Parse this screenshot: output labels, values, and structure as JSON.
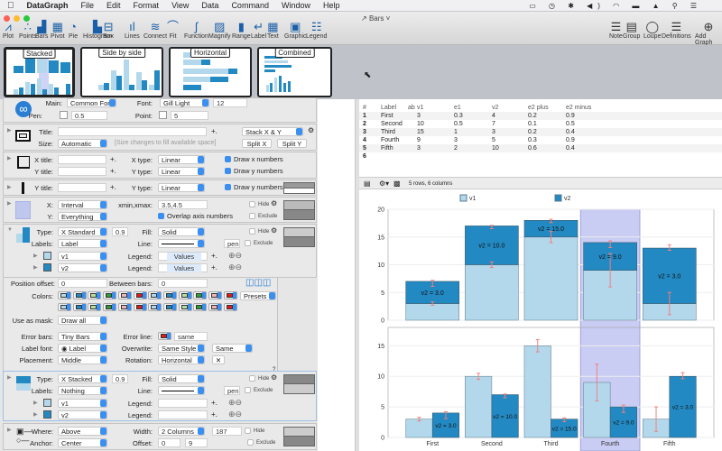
{
  "menubar": {
    "app": "DataGraph",
    "items": [
      "File",
      "Edit",
      "Format",
      "View",
      "Data",
      "Command",
      "Window",
      "Help"
    ]
  },
  "window": {
    "title": "Bars"
  },
  "toolbar": {
    "left": [
      "Plot",
      "Points",
      "Bars",
      "Pivot",
      "Pie",
      "Histogram",
      "Box",
      "Lines",
      "Connect",
      "Fit",
      "Function",
      "Magnify",
      "Range",
      "Label",
      "Text",
      "Graphic",
      "Legend"
    ],
    "right": [
      "Note",
      "Group",
      "Loupe",
      "Definitions",
      "Add Graph"
    ]
  },
  "thumbnails": [
    "Stacked",
    "Side by side",
    "Horizontal",
    "Combined"
  ],
  "panel": {
    "style": {
      "main_label": "Main:",
      "main": "Common Font",
      "font_label": "Font:",
      "font": "Gill Light",
      "font_size": "12",
      "pen_label": "Pen:",
      "pen": "0.5",
      "point_label": "Point:",
      "point": "5"
    },
    "canvas": {
      "title_label": "Title:",
      "title": "",
      "layout": "Stack X & Y",
      "size_label": "Size:",
      "size": "Automatic",
      "size_hint": "[Size changes to fill available space]",
      "split_x": "Split X",
      "split_y": "Split Y"
    },
    "axes": {
      "xtitle_label": "X title:",
      "ytitle_label": "Y title:",
      "xtype_label": "X type:",
      "xtype": "Linear",
      "ytype_label": "Y type:",
      "ytype": "Linear",
      "draw_x": "Draw x numbers",
      "draw_y": "Draw y numbers"
    },
    "axes2": {
      "ytitle_label": "Y title:",
      "ytype_label": "Y type:",
      "ytype": "Linear",
      "draw_y": "Draw y numbers"
    },
    "range": {
      "x_label": "X:",
      "x": "Interval",
      "xminmax_label": "xmin,xmax:",
      "xminmax": "3.5,4.5",
      "y_label": "Y:",
      "y": "Everything",
      "overlap": "Overlap axis numbers",
      "hide": "Hide",
      "exclude": "Exclude"
    },
    "bars1": {
      "type_label": "Type:",
      "type": "X Standard",
      "width": "0.9",
      "fill_label": "Fill:",
      "fill": "Solid",
      "labels_label": "Labels:",
      "labels": "Label",
      "line_label": "Line:",
      "pen": "pen",
      "hide": "Hide",
      "exclude": "Exclude",
      "series": [
        {
          "name": "v1",
          "legend_label": "Legend:",
          "legend": "Values",
          "color": "#b3d8ec"
        },
        {
          "name": "v2",
          "legend_label": "Legend:",
          "legend": "Values",
          "color": "#2389c2"
        }
      ],
      "pos_offset_label": "Position offset:",
      "pos_offset": "0",
      "between_label": "Between bars:",
      "between": "0",
      "colors_label": "Colors:",
      "presets": "Presets",
      "palette": [
        "#b3d8ec",
        "#2389c2",
        "#b8e09a",
        "#2e9e36",
        "#f2b4b4",
        "#e01b1b",
        "#b3d8ec",
        "#2389c2",
        "#b8e09a",
        "#2e9e36",
        "#f2b4b4",
        "#e01b1b"
      ],
      "mask_label": "Use as mask:",
      "mask": "Draw all",
      "errbars_label": "Error bars:",
      "errbars": "Tiny Bars",
      "errline_label": "Error line:",
      "errline": "same",
      "errcolor": "#e01b1b",
      "labelfont_label": "Label font:",
      "labelfont": "Label",
      "overwrite_label": "Overwrite:",
      "overwrite": "Same Style",
      "same": "Same",
      "placement_label": "Placement:",
      "placement": "Middle",
      "rotation_label": "Rotation:",
      "rotation": "Horizontal",
      "help": "?"
    },
    "bars2": {
      "type_label": "Type:",
      "type": "X Stacked",
      "width": "0.9",
      "fill_label": "Fill:",
      "fill": "Solid",
      "labels_label": "Labels:",
      "labels": "Nothing",
      "line_label": "Line:",
      "pen": "pen",
      "hide": "Hide",
      "exclude": "Exclude",
      "series": [
        {
          "name": "v1",
          "legend_label": "Legend:",
          "legend": "",
          "color": "#b3d8ec"
        },
        {
          "name": "v2",
          "legend_label": "Legend:",
          "legend": "",
          "color": "#2389c2"
        }
      ]
    },
    "legend": {
      "where_label": "Where:",
      "where": "Above",
      "width_label": "Width:",
      "width": "2 Columns",
      "width_val": "187",
      "anchor_label": "Anchor:",
      "anchor": "Center",
      "offset_label": "Offset:",
      "offset_x": "0",
      "offset_y": "9",
      "hide": "Hide",
      "exclude": "Exclude"
    }
  },
  "table": {
    "headers": [
      "#",
      "Label",
      "ab",
      "v1",
      "e1",
      "v2",
      "e2 plus",
      "e2 minus"
    ],
    "rows": [
      [
        "1",
        "First",
        "",
        "3",
        "0.3",
        "4",
        "0.2",
        "0.9"
      ],
      [
        "2",
        "Second",
        "",
        "10",
        "0.5",
        "7",
        "0.1",
        "0.5"
      ],
      [
        "3",
        "Third",
        "",
        "15",
        "1",
        "3",
        "0.2",
        "0.4"
      ],
      [
        "4",
        "Fourth",
        "",
        "9",
        "3",
        "5",
        "0.3",
        "0.9"
      ],
      [
        "5",
        "Fifth",
        "",
        "3",
        "2",
        "10",
        "0.6",
        "0.4"
      ],
      [
        "6",
        "",
        "",
        "",
        "",
        "",
        "",
        ""
      ]
    ],
    "status": "5 rows, 6 columns"
  },
  "chart_data": [
    {
      "type": "bar",
      "mode": "stacked",
      "categories": [
        "First",
        "Second",
        "Third",
        "Fourth",
        "Fifth"
      ],
      "series": [
        {
          "name": "v1",
          "values": [
            3,
            10,
            15,
            9,
            3
          ],
          "errors": [
            0.3,
            0.5,
            1,
            3,
            2
          ],
          "color": "#b3d8ec"
        },
        {
          "name": "v2",
          "values": [
            4,
            7,
            3,
            5,
            10
          ],
          "errors_plus": [
            0.2,
            0.1,
            0.2,
            0.3,
            0.6
          ],
          "errors_minus": [
            0.9,
            0.5,
            0.4,
            0.9,
            0.4
          ],
          "color": "#2389c2"
        }
      ],
      "bar_labels": [
        "v2 = 3.0",
        "v2 = 10.0",
        "v2 = 15.0",
        "v2 = 9.0",
        "v2 = 3.0"
      ],
      "ylim": [
        0,
        20
      ],
      "yticks": [
        "0",
        "5",
        "10",
        "15",
        "20"
      ],
      "highlight_x": [
        3.5,
        4.5
      ],
      "legend": "top"
    },
    {
      "type": "bar",
      "mode": "side-by-side",
      "categories": [
        "First",
        "Second",
        "Third",
        "Fourth",
        "Fifth"
      ],
      "series": [
        {
          "name": "v1",
          "values": [
            3,
            10,
            15,
            9,
            3
          ],
          "errors": [
            0.3,
            0.5,
            1,
            3,
            2
          ],
          "color": "#b3d8ec"
        },
        {
          "name": "v2",
          "values": [
            4,
            7,
            3,
            5,
            10
          ],
          "errors_plus": [
            0.2,
            0.1,
            0.2,
            0.3,
            0.6
          ],
          "errors_minus": [
            0.9,
            0.5,
            0.4,
            0.9,
            0.4
          ],
          "color": "#2389c2"
        }
      ],
      "bar_labels": [
        "v2 = 3.0",
        "v2 = 10.0",
        "v2 = 15.0",
        "v2 = 9.0",
        "v2 = 3.0"
      ],
      "ylim": [
        0,
        18
      ],
      "yticks": [
        "0",
        "5",
        "10",
        "15"
      ],
      "highlight_x": [
        3.5,
        4.5
      ]
    }
  ]
}
